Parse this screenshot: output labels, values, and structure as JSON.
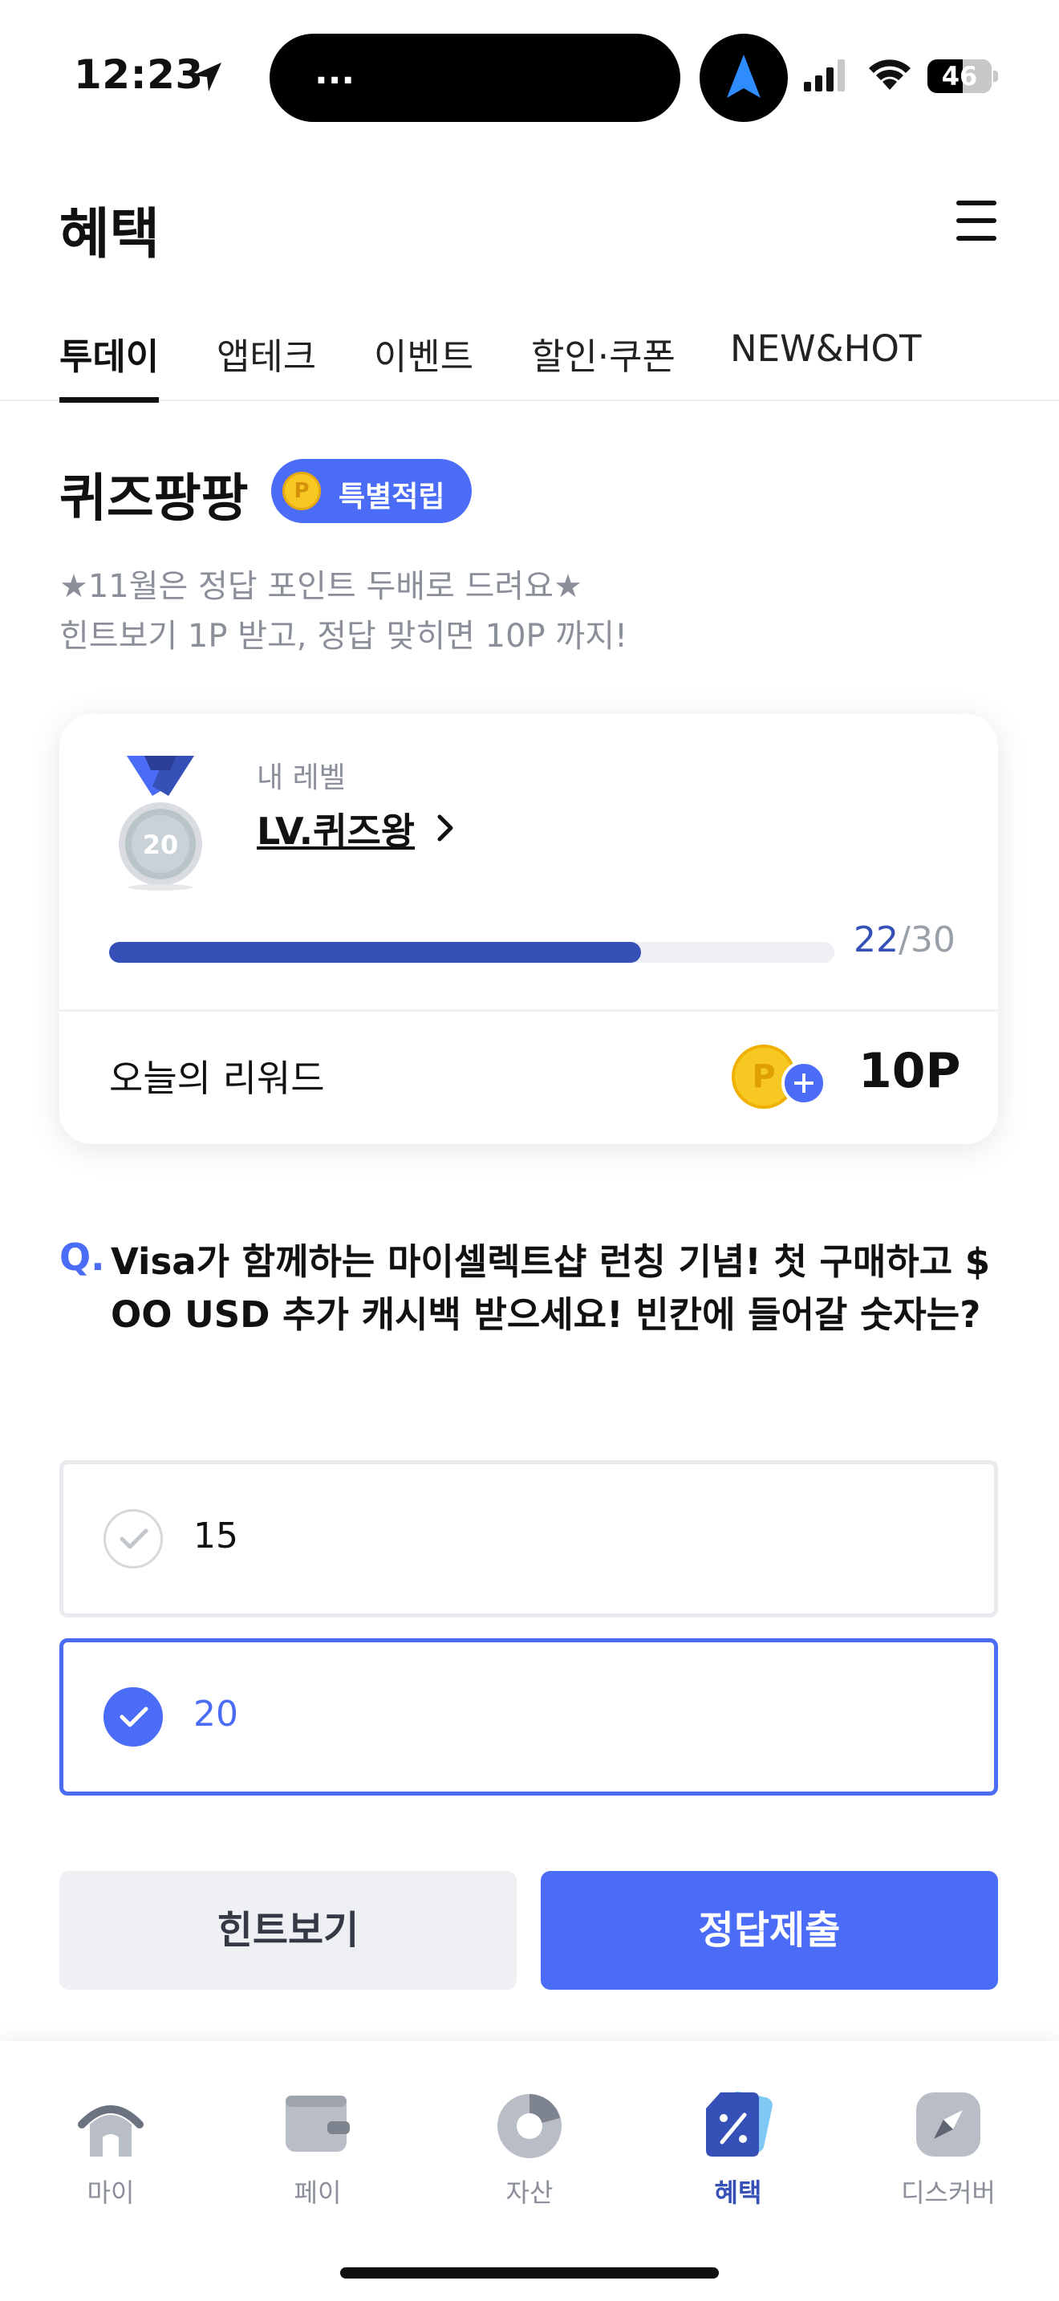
{
  "status_bar": {
    "time": "12:23",
    "island_text": "...",
    "battery": "46"
  },
  "header": {
    "title": "혜택"
  },
  "tabs": [
    {
      "label": "투데이",
      "active": true
    },
    {
      "label": "앱테크",
      "active": false
    },
    {
      "label": "이벤트",
      "active": false
    },
    {
      "label": "할인·쿠폰",
      "active": false
    },
    {
      "label": "NEW&HOT",
      "active": false
    }
  ],
  "quiz": {
    "title": "퀴즈팡팡",
    "badge_coin": "P",
    "badge_label": "특별적립",
    "subtitle_line1": "★11월은 정답 포인트 두배로 드려요★",
    "subtitle_line2": "힌트보기 1P 받고, 정답 맞히면 10P 까지!"
  },
  "level_card": {
    "medal_number": "20",
    "level_label": "내 레벨",
    "level_name": "LV.퀴즈왕",
    "progress_current": "22",
    "progress_total": "/30",
    "progress_fraction": 0.733,
    "reward_label": "오늘의 리워드",
    "reward_coin": "P",
    "reward_value": "10P"
  },
  "question": {
    "mark": "Q.",
    "text": "Visa가 함께하는 마이셀렉트샵 런칭 기념! 첫 구매하고 $ OO USD 추가 캐시백 받으세요! 빈칸에 들어갈 숫자는?"
  },
  "options": [
    {
      "label": "15",
      "selected": false
    },
    {
      "label": "20",
      "selected": true
    }
  ],
  "buttons": {
    "hint": "힌트보기",
    "submit": "정답제출"
  },
  "bottom_nav": [
    {
      "label": "마이",
      "icon": "home-icon",
      "active": false
    },
    {
      "label": "페이",
      "icon": "wallet-icon",
      "active": false
    },
    {
      "label": "자산",
      "icon": "pie-chart-icon",
      "active": false
    },
    {
      "label": "혜택",
      "icon": "benefit-tag-icon",
      "active": true
    },
    {
      "label": "디스커버",
      "icon": "compass-icon",
      "active": false
    }
  ],
  "colors": {
    "accent": "#4a6cf7",
    "progress": "#3550b6",
    "muted_text": "#8a8f99"
  }
}
